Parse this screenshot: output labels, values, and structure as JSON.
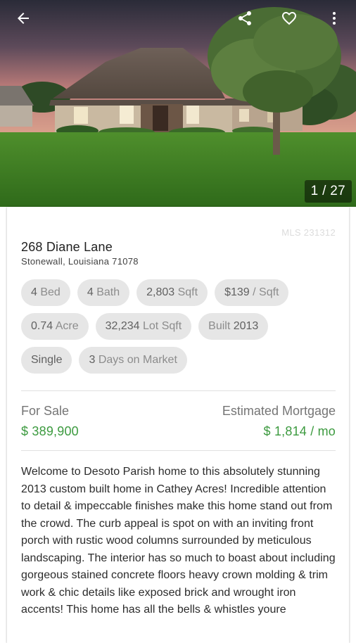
{
  "toolbar": {
    "icons": {
      "back": "arrow-back-icon",
      "share": "share-icon",
      "favorite": "heart-outline-icon",
      "more": "more-vertical-icon"
    }
  },
  "gallery": {
    "counter": "1 / 27"
  },
  "listing": {
    "mls": "MLS 231312",
    "address_line1": "268 Diane Lane",
    "address_line2": "Stonewall, Louisiana 71078",
    "chip_rows": [
      [
        {
          "value": "4",
          "unit": "Bed"
        },
        {
          "value": "4",
          "unit": "Bath"
        },
        {
          "value": "2,803",
          "unit": "Sqft"
        },
        {
          "value": "$139",
          "unit": "/ Sqft"
        }
      ],
      [
        {
          "value": "0.74",
          "unit": "Acre"
        },
        {
          "value": "32,234",
          "unit": "Lot Sqft"
        },
        {
          "value": "Built",
          "unit": "2013"
        }
      ],
      [
        {
          "value": "Single",
          "unit": ""
        },
        {
          "value": "3",
          "unit": "Days on Market"
        }
      ]
    ],
    "status_label": "For Sale",
    "price": "$ 389,900",
    "mortgage_label": "Estimated Mortgage",
    "mortgage_value": "$ 1,814 / mo",
    "description": "Welcome to Desoto Parish home to this absolutely stunning 2013 custom built home in Cathey Acres! Incredible attention to detail & impeccable finishes make this home stand out from the crowd. The curb appeal is spot on with an inviting front porch with rustic wood columns surrounded by meticulous landscaping. The interior has so much to boast about including gorgeous stained concrete floors heavy crown molding & trim work & chic details like exposed brick and wrought iron accents! This home has all the bells & whistles youre"
  },
  "colors": {
    "price_green": "#3c9a3f",
    "chip_bg": "#e6e6e6"
  }
}
